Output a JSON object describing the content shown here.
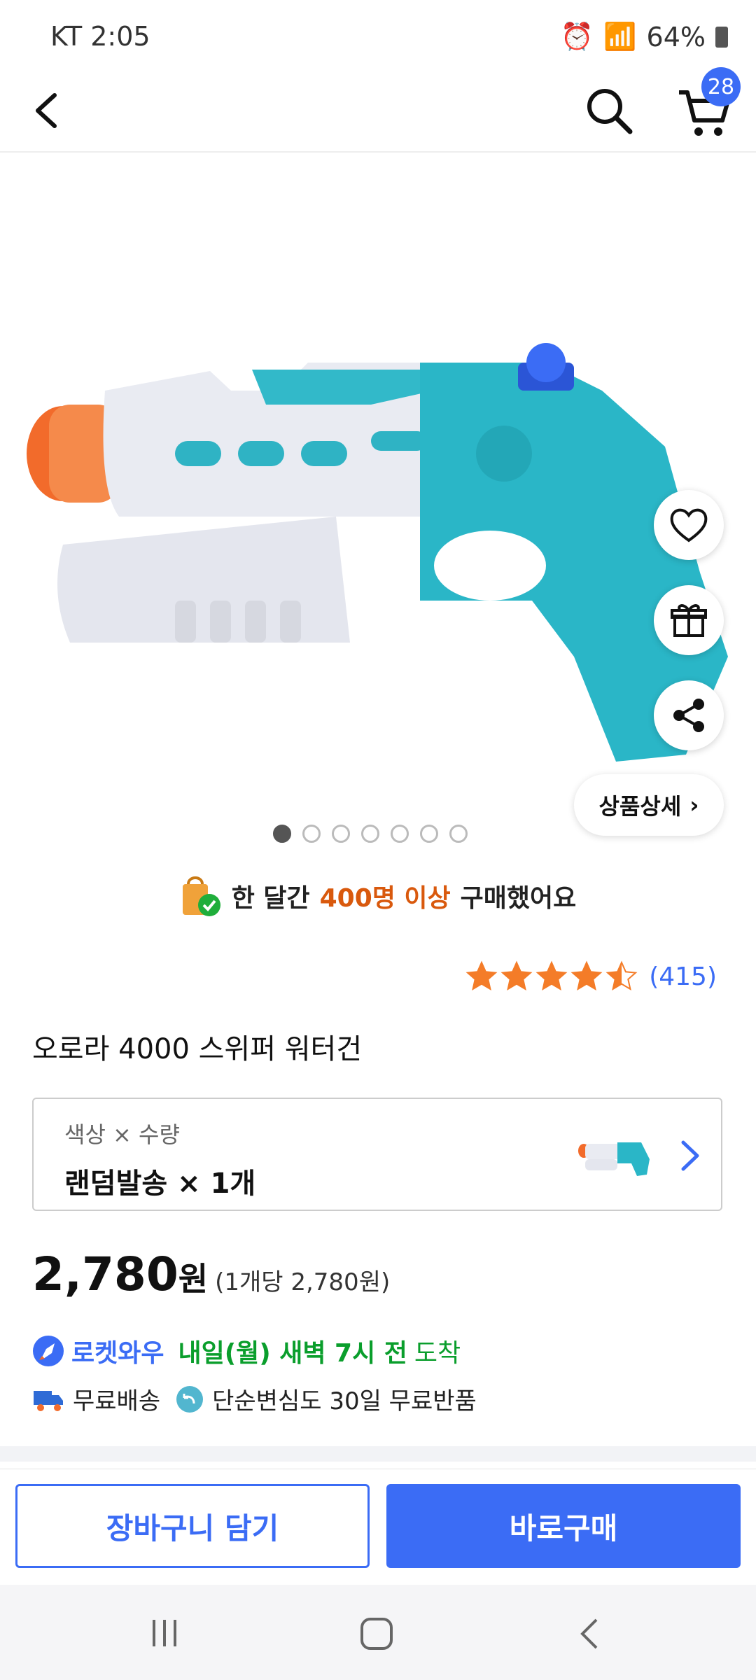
{
  "status_bar": {
    "carrier_time": "KT 2:05",
    "battery": "64%"
  },
  "header": {
    "cart_count": "28"
  },
  "gallery": {
    "detail_label": "상품상세",
    "page_count": 7,
    "active_page": 1
  },
  "sold_notice": {
    "prefix": "한 달간",
    "highlight": "400명 이상",
    "suffix": "구매했어요"
  },
  "rating": {
    "stars": 4.5,
    "count": "(415)"
  },
  "product": {
    "title": "오로라 4000 스위퍼 워터건"
  },
  "option": {
    "label": "색상 × 수량",
    "value": "랜덤발송 × 1개"
  },
  "price": {
    "amount": "2,780",
    "currency": "원",
    "unit_price": "(1개당 2,780원)"
  },
  "delivery": {
    "brand": "로켓와우",
    "date": "내일(월) 새벽 7시 전",
    "arrive": "도착"
  },
  "benefits": {
    "free_shipping": "무료배송",
    "free_return": "단순변심도 30일 무료반품"
  },
  "actions": {
    "add_to_cart": "장바구니 담기",
    "buy_now": "바로구매"
  },
  "colors": {
    "accent": "#3b6cf5",
    "highlight": "#d9590d",
    "delivery_green": "#0a9e2c",
    "star": "#f47c28"
  }
}
